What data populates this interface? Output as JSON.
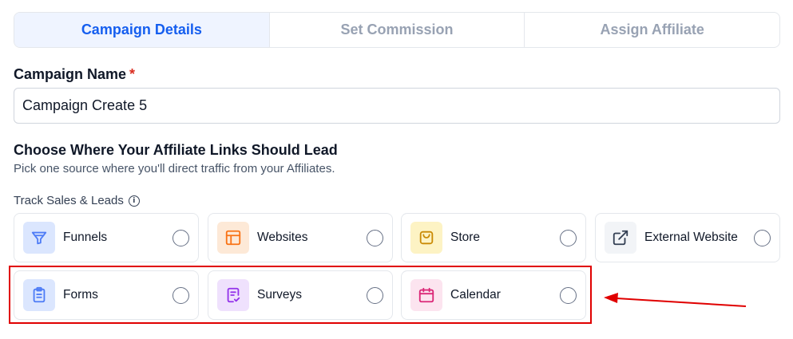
{
  "tabs": [
    {
      "label": "Campaign Details",
      "active": true
    },
    {
      "label": "Set Commission",
      "active": false
    },
    {
      "label": "Assign Affiliate",
      "active": false
    }
  ],
  "campaign_name": {
    "label": "Campaign Name",
    "required_mark": "*",
    "value": "Campaign Create 5"
  },
  "destination": {
    "heading": "Choose Where Your Affiliate Links Should Lead",
    "subheading": "Pick one source where you'll direct traffic from your Affiliates.",
    "track_label": "Track Sales & Leads",
    "track_info_glyph": "i"
  },
  "options": [
    {
      "id": "funnels",
      "label": "Funnels",
      "icon": "funnel-icon",
      "color": "#4e7cf6",
      "bg": "#dbe6fe",
      "selected": false
    },
    {
      "id": "websites",
      "label": "Websites",
      "icon": "layout-icon",
      "color": "#f97316",
      "bg": "#fde9d7",
      "selected": false
    },
    {
      "id": "store",
      "label": "Store",
      "icon": "shopping-bag-icon",
      "color": "#ca8a04",
      "bg": "#fdf3c4",
      "selected": false
    },
    {
      "id": "external-website",
      "label": "External Website",
      "icon": "external-link-icon",
      "color": "#344054",
      "bg": "#f2f4f7",
      "selected": false
    },
    {
      "id": "forms",
      "label": "Forms",
      "icon": "clipboard-icon",
      "color": "#4e7cf6",
      "bg": "#dbe6fe",
      "selected": false
    },
    {
      "id": "surveys",
      "label": "Surveys",
      "icon": "survey-icon",
      "color": "#9333ea",
      "bg": "#efe1fd",
      "selected": false
    },
    {
      "id": "calendar",
      "label": "Calendar",
      "icon": "calendar-icon",
      "color": "#db2777",
      "bg": "#fce4ef",
      "selected": false
    }
  ],
  "annotation_color": "#e00000"
}
